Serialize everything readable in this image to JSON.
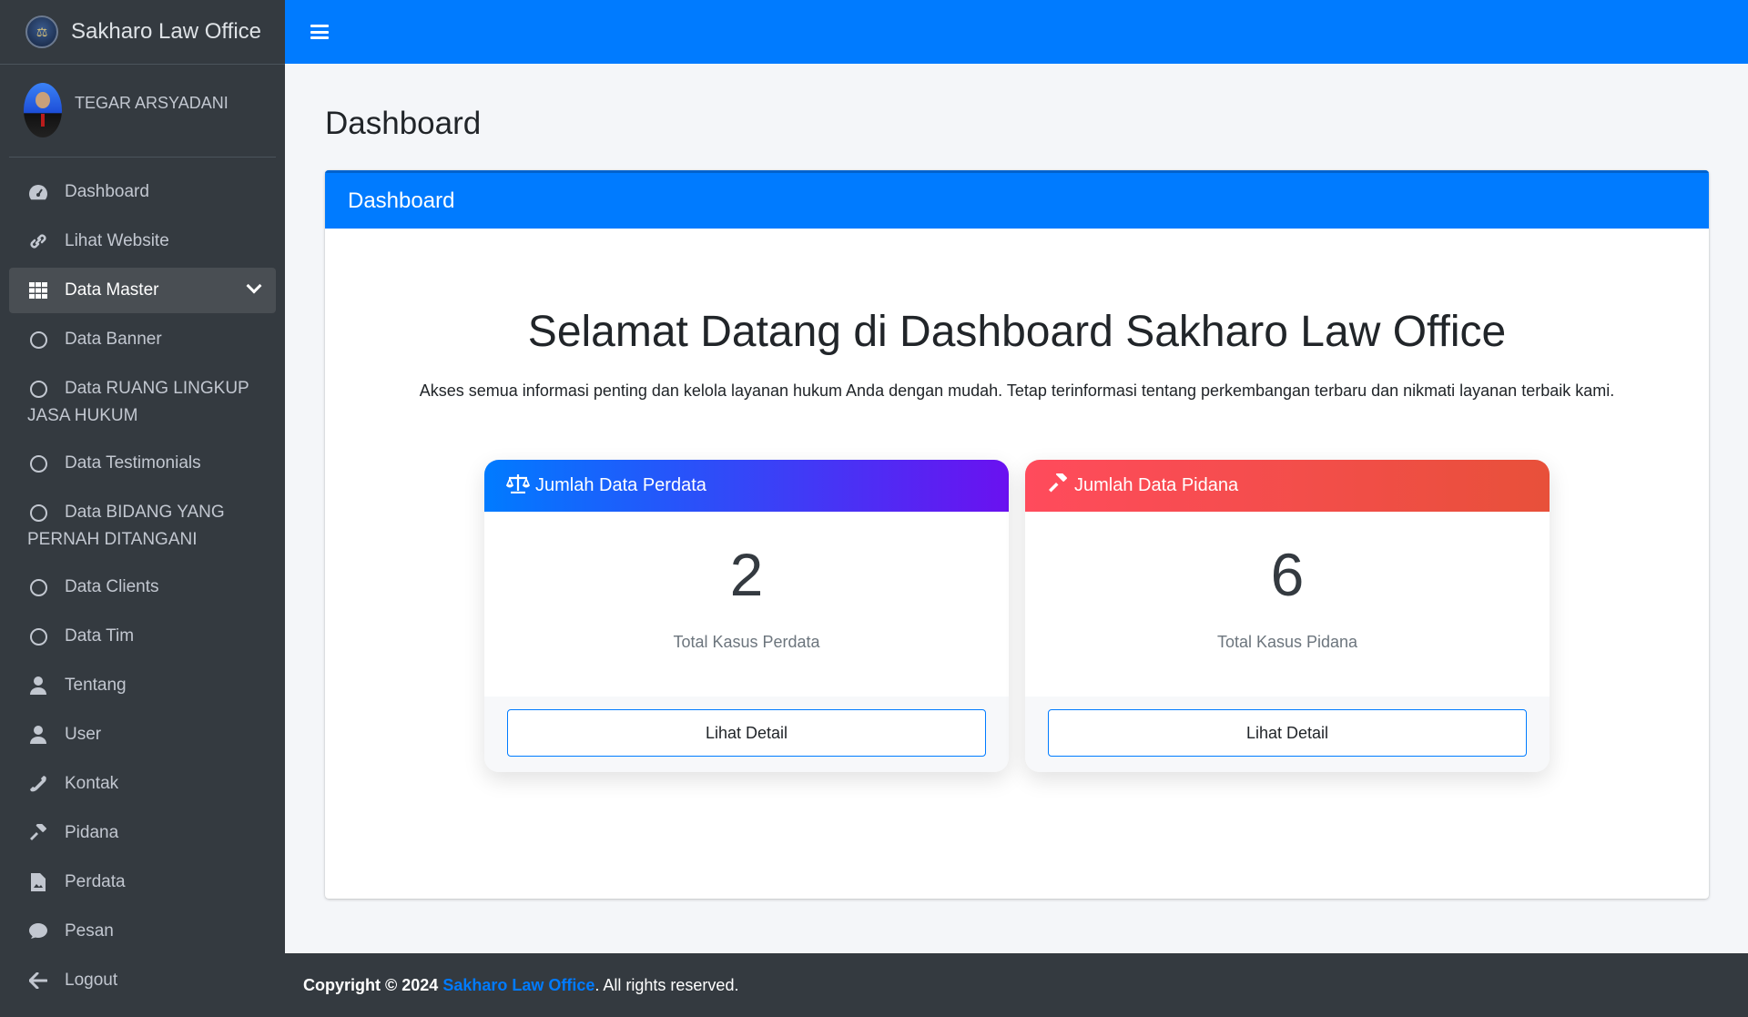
{
  "brand": {
    "name": "Sakharo Law Office",
    "logo_icon": "scales-logo-icon"
  },
  "user": {
    "name": "TEGAR ARSYADANI"
  },
  "sidebar": {
    "items": [
      {
        "label": "Dashboard",
        "icon": "tachometer-icon"
      },
      {
        "label": "Lihat Website",
        "icon": "link-icon"
      },
      {
        "label": "Data Master",
        "icon": "grid-icon",
        "active": true
      },
      {
        "label": "Data Banner",
        "icon": "circle-icon"
      },
      {
        "label": "Data RUANG LINGKUP JASA HUKUM",
        "label_line1": "Data RUANG LINGKUP",
        "label_line2": "JASA HUKUM",
        "icon": "circle-icon"
      },
      {
        "label": "Data Testimonials",
        "icon": "circle-icon"
      },
      {
        "label": "Data BIDANG YANG PERNAH DITANGANI",
        "label_line1": "Data BIDANG YANG",
        "label_line2": "PERNAH DITANGANI",
        "icon": "circle-icon"
      },
      {
        "label": "Data Clients",
        "icon": "circle-icon"
      },
      {
        "label": "Data Tim",
        "icon": "circle-icon"
      },
      {
        "label": "Tentang",
        "icon": "user-icon"
      },
      {
        "label": "User",
        "icon": "user-icon"
      },
      {
        "label": "Kontak",
        "icon": "phone-icon"
      },
      {
        "label": "Pidana",
        "icon": "gavel-icon"
      },
      {
        "label": "Perdata",
        "icon": "file-icon"
      },
      {
        "label": "Pesan",
        "icon": "comment-icon"
      },
      {
        "label": "Logout",
        "icon": "arrow-left-icon"
      }
    ]
  },
  "page": {
    "title": "Dashboard"
  },
  "card": {
    "header": "Dashboard",
    "welcome": "Selamat Datang di Dashboard Sakharo Law Office",
    "subtext": "Akses semua informasi penting dan kelola layanan hukum Anda dengan mudah. Tetap terinformasi tentang perkembangan terbaru dan nikmati layanan terbaik kami."
  },
  "stats": {
    "perdata": {
      "title": "Jumlah Data Perdata",
      "icon": "balance-scale-icon",
      "value": "2",
      "label": "Total Kasus Perdata",
      "button": "Lihat Detail"
    },
    "pidana": {
      "title": "Jumlah Data Pidana",
      "icon": "gavel-icon",
      "value": "6",
      "label": "Total Kasus Pidana",
      "button": "Lihat Detail"
    }
  },
  "footer": {
    "prefix": "Copyright © 2024",
    "link": "Sakharo Law Office",
    "suffix": ". All rights reserved."
  },
  "colors": {
    "primary": "#007bff",
    "sidebar": "#343a40",
    "pidana_red": "#ff4b5c",
    "perdata_purple": "#6a11f0"
  }
}
